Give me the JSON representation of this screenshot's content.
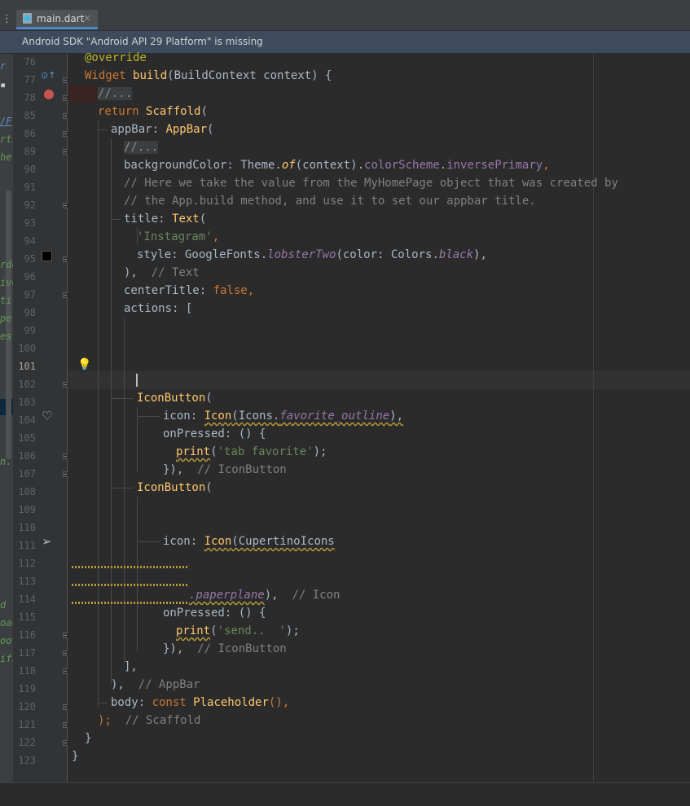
{
  "tab": {
    "filename": "main.dart",
    "close": "×",
    "menu": "⋮"
  },
  "banner": {
    "text": "Android SDK \"Android API 29 Platform\" is missing"
  },
  "colors": {
    "keyword": "#cc7832",
    "function": "#ffc66d",
    "string": "#6a8759",
    "comment": "#808080",
    "property": "#9876aa",
    "breakpoint": "#c75450"
  },
  "left_panel_fragments": [
    "r",
    "/F",
    "rts",
    "he",
    "rde",
    "ive",
    "tiv",
    "per",
    "es",
    "n.",
    "d T",
    "oac",
    "oot",
    "ifi"
  ],
  "line_numbers": [
    "76",
    "77",
    "78",
    "85",
    "86",
    "89",
    "90",
    "91",
    "92",
    "93",
    "94",
    "95",
    "96",
    "97",
    "98",
    "99",
    "100",
    "101",
    "102",
    "103",
    "104",
    "105",
    "106",
    "107",
    "108",
    "109",
    "110",
    "111",
    "112",
    "113",
    "114",
    "115",
    "116",
    "117",
    "118",
    "119",
    "120",
    "121",
    "122",
    "123"
  ],
  "code": {
    "l76": "@override",
    "l77_kw": "Widget ",
    "l77_fn": "build",
    "l77_rest": "(BuildContext context) {",
    "l78": "//...",
    "l85_kw": "return ",
    "l85_fn": "Scaffold",
    "l85_rest": "(",
    "l86_a": "appBar: ",
    "l86_fn": "AppBar",
    "l86_b": "(",
    "l87": "//...",
    "l89_a": "backgroundColor: Theme.",
    "l89_of": "of",
    "l89_b": "(context).",
    "l89_p1": "colorScheme",
    "l89_c": ".",
    "l89_p2": "inversePrimary",
    "l89_d": ",",
    "l90": "// Here we take the value from the MyHomePage object that was created by",
    "l91": "// the App.build method, and use it to set our appbar title.",
    "l92_a": "title: ",
    "l92_fn": "Text",
    "l92_b": "(",
    "l93": "'Instagram'",
    "l93_c": ",",
    "l94_a": "style: GoogleFonts.",
    "l94_m": "lobsterTwo",
    "l94_b": "(color: Colors.",
    "l94_p": "black",
    "l94_c": "),",
    "l95_a": "),  ",
    "l95_cm": "// Text",
    "l96_a": "centerTitle: ",
    "l96_kw": "false",
    "l96_b": ",",
    "l97": "actions: [",
    "l102_fn": "IconButton",
    "l102_b": "(",
    "l103_a": "icon: ",
    "l103_fn": "Icon",
    "l103_b": "(Icons.",
    "l103_p": "favorite_outline",
    "l103_c": "),",
    "l104": "onPressed: () {",
    "l105_fn": "print",
    "l105_a": "(",
    "l105_s": "'tab favorite'",
    "l105_b": ");",
    "l106_a": "}),  ",
    "l106_cm": "// IconButton",
    "l107_fn": "IconButton",
    "l107_b": "(",
    "l110_a": "icon: ",
    "l110_fn": "Icon",
    "l110_b": "(CupertinoIcons",
    "l113_p": ".paperplane",
    "l113_a": "),  ",
    "l113_cm": "// Icon",
    "l114": "onPressed: () {",
    "l115_fn": "print",
    "l115_a": "(",
    "l115_s": "'send..  '",
    "l115_b": ");",
    "l116_a": "}),  ",
    "l116_cm": "// IconButton",
    "l117": "],",
    "l118_a": "),  ",
    "l118_cm": "// AppBar",
    "l119_a": "body: ",
    "l119_kw": "const ",
    "l119_fn": "Placeholder",
    "l119_b": "(),",
    "l120_a": ");  ",
    "l120_cm": "// Scaffold",
    "l121": "}",
    "l122": "}"
  }
}
